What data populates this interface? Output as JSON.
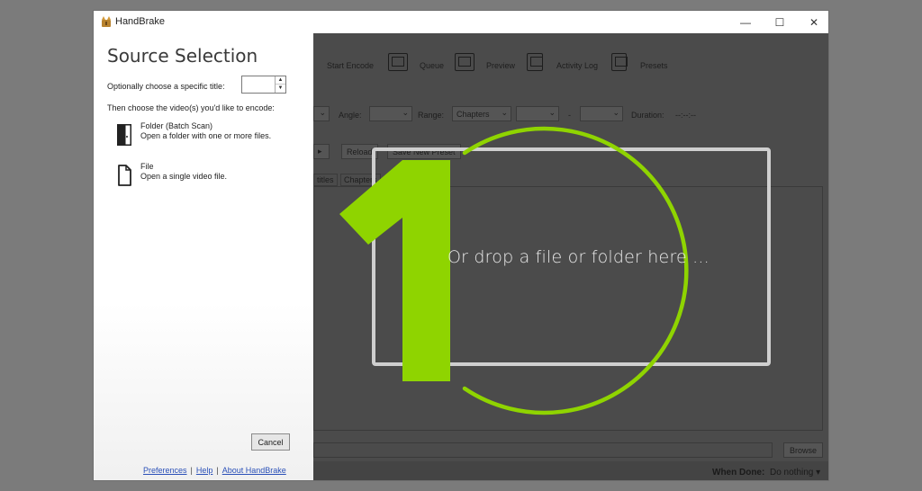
{
  "window": {
    "title": "HandBrake",
    "controls": {
      "minimize": "—",
      "maximize": "☐",
      "close": "✕"
    }
  },
  "toolbar": {
    "items": [
      {
        "label": "Start Encode",
        "icon": "start-encode-icon"
      },
      {
        "label": "Queue",
        "icon": "queue-icon"
      },
      {
        "label": "Preview",
        "icon": "preview-icon"
      },
      {
        "label": "Activity Log",
        "icon": "activity-log-icon"
      },
      {
        "label": "Presets",
        "icon": "presets-icon"
      }
    ]
  },
  "source_row": {
    "angle_label": "Angle:",
    "range_label": "Range:",
    "range_value": "Chapters",
    "range_dash": "-",
    "duration_label": "Duration:",
    "duration_value": "--:--:--"
  },
  "preset_row": {
    "play_glyph": "▸",
    "reload_label": "Reload",
    "save_preset_label": "Save New Preset"
  },
  "tabs": {
    "subtitles": "titles",
    "chapters": "Chapters"
  },
  "destination": {
    "browse_label": "Browse"
  },
  "status_bar": {
    "when_done_label": "When Done:",
    "when_done_value": "Do nothing ▾"
  },
  "drop_zone": {
    "text": "Or drop a file or folder here ..."
  },
  "overlay": {
    "step_number": "1",
    "accent_color": "#8fd400"
  },
  "source_selection": {
    "title": "Source Selection",
    "title_prompt": "Optionally choose a specific title:",
    "title_value": "",
    "spin_up": "▲",
    "spin_down": "▼",
    "choose_prompt": "Then choose the video(s) you'd like to encode:",
    "options": [
      {
        "title": "Folder (Batch Scan)",
        "description": "Open a folder with one or more files.",
        "icon": "folder-icon"
      },
      {
        "title": "File",
        "description": "Open a single video file.",
        "icon": "file-icon"
      }
    ],
    "cancel_label": "Cancel",
    "links": {
      "preferences": "Preferences",
      "help": "Help",
      "about": "About HandBrake",
      "separator": "|"
    }
  }
}
